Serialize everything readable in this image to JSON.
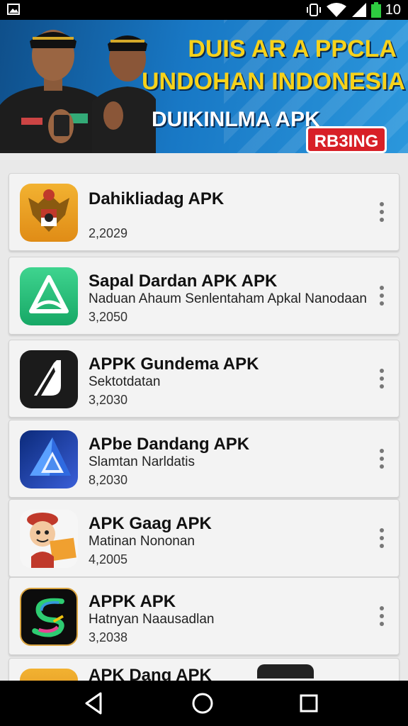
{
  "status_bar": {
    "time": "10",
    "icons": [
      "image-notification-icon",
      "vibrate-icon",
      "wifi-icon",
      "signal-icon",
      "battery-icon"
    ]
  },
  "banner": {
    "line1": "DUIS AR A PPCLA",
    "line2": "UNDOHAN INDONESIA",
    "subtitle": "DUIKINLMA APK",
    "button": "RB3ING"
  },
  "apps": [
    {
      "title": "Dahikliadag APK",
      "desc": "",
      "version": "2,2029",
      "icon": "garuda-emblem-icon"
    },
    {
      "title": "Sapal Dardan APK APK",
      "desc": "Naduan Ahaum Senlentaham Apkal Nanodaan",
      "version": "3,2050",
      "icon": "green-triangle-logo-icon"
    },
    {
      "title": "APPK Gundema APK",
      "desc": "Sektotdatan",
      "version": "3,2030",
      "icon": "black-slash-logo-icon"
    },
    {
      "title": "APbe Dandang APK",
      "desc": "Slamtan Narldatis",
      "version": "8,2030",
      "icon": "blue-prism-logo-icon"
    },
    {
      "title": "APK Gaag APK",
      "desc": "Matinan Nononan",
      "version": "4,2005",
      "icon": "cartoon-mascot-icon"
    },
    {
      "title": "APPK APK",
      "desc": "Hatnyan Naausadlan",
      "version": "3,2038",
      "icon": "neon-s-logo-icon"
    },
    {
      "title": "APK Dang APK",
      "desc": "",
      "version": "",
      "icon": "gold-emblem-icon"
    }
  ],
  "navigation": {
    "back": "back-icon",
    "home": "home-icon",
    "recents": "recents-icon"
  },
  "colors": {
    "banner_blue": "#1878c5",
    "banner_yellow": "#f7d21a",
    "banner_button_red": "#d82027"
  }
}
